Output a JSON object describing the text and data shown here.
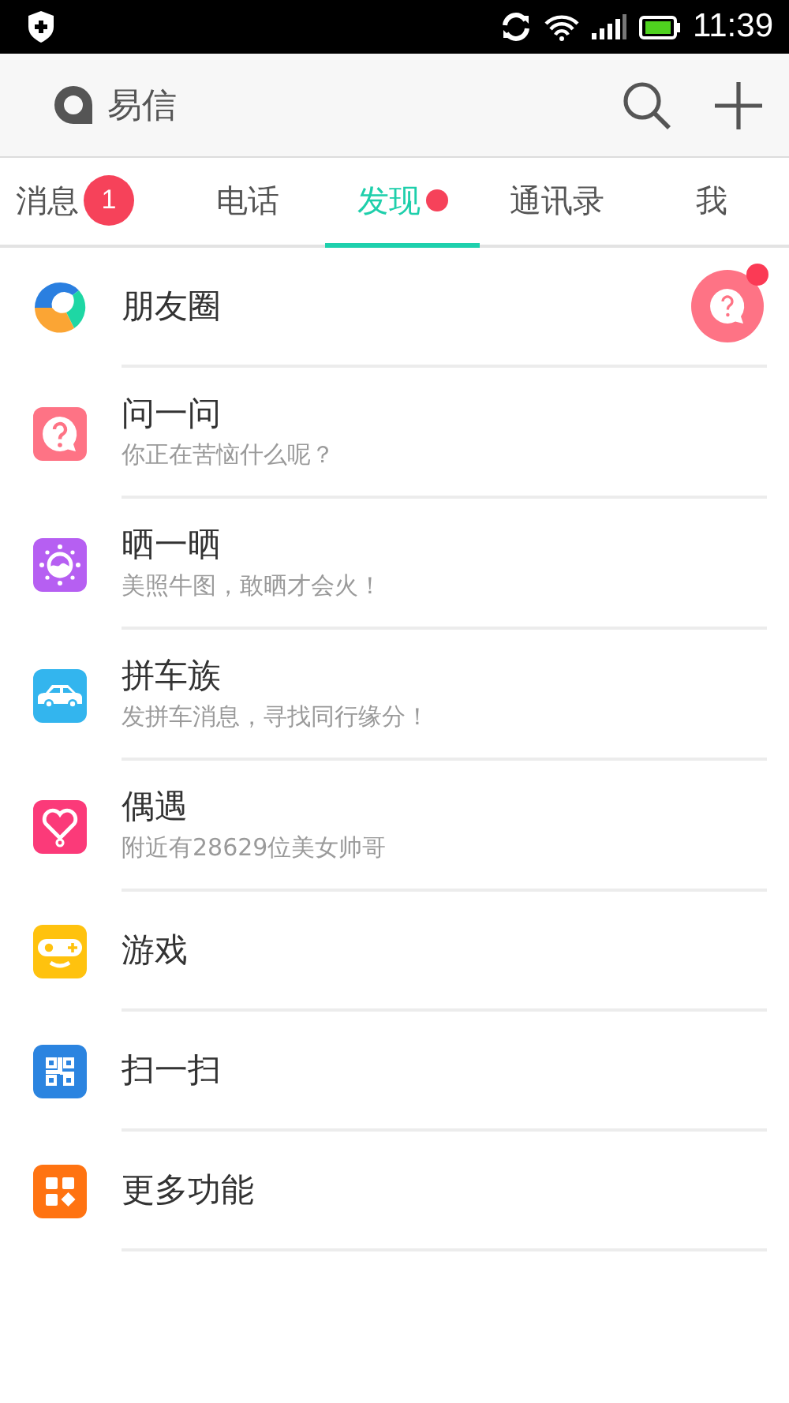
{
  "status_bar": {
    "time": "11:39"
  },
  "app_bar": {
    "title": "易信"
  },
  "tabs": [
    {
      "label": "消息",
      "selected": false,
      "badge": "1",
      "dot": false
    },
    {
      "label": "电话",
      "selected": false,
      "dot": false
    },
    {
      "label": "发现",
      "selected": true,
      "dot": true
    },
    {
      "label": "通讯录",
      "selected": false,
      "dot": false
    },
    {
      "label": "我",
      "selected": false,
      "dot": false
    }
  ],
  "items": [
    {
      "kind": "moments",
      "title": "朋友圈",
      "alert": true
    },
    {
      "kind": "ask",
      "title": "问一问",
      "subtitle": "你正在苦恼什么呢？",
      "alert": false
    },
    {
      "kind": "share",
      "title": "晒一晒",
      "subtitle": "美照牛图，敢晒才会火！",
      "alert": false
    },
    {
      "kind": "carpool",
      "title": "拼车族",
      "subtitle": "发拼车消息，寻找同行缘分！",
      "alert": false
    },
    {
      "kind": "encounter",
      "title": "偶遇",
      "subtitle": "附近有28629位美女帅哥",
      "alert": false
    },
    {
      "kind": "game",
      "title": "游戏",
      "alert": false
    },
    {
      "kind": "scan",
      "title": "扫一扫",
      "alert": false
    },
    {
      "kind": "more",
      "title": "更多功能",
      "alert": false
    }
  ]
}
